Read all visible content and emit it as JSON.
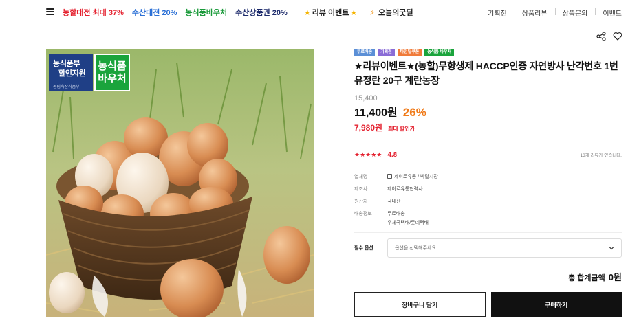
{
  "topnav": {
    "promos": [
      {
        "label": "농할대전 최대 37%",
        "color": "#e4202e"
      },
      {
        "label": "수산대전 20%",
        "color": "#2a6fd6"
      },
      {
        "label": "농식품바우처",
        "color": "#1a9a3a"
      },
      {
        "label": "수산상품권 20%",
        "color": "#1c2a6b"
      }
    ],
    "review_event": "리뷰 이벤트",
    "today_deal": "오늘의굿딜",
    "right_links": [
      "기획전",
      "상품리뷰",
      "상품문의",
      "이벤트"
    ]
  },
  "image": {
    "badge_line1": "농식품부",
    "badge_line2": "할인지원",
    "badge_line3": "농림축산식품부",
    "voucher_line1": "농식품",
    "voucher_line2": "바우처"
  },
  "product": {
    "tags": [
      "무료배송",
      "기획전",
      "타임딜쿠폰",
      "농식품 바우처"
    ],
    "title": "★리뷰이벤트★(농할)무항생제 HACCP인증 자연방사 난각번호 1번 유정란 20구 계란농장",
    "original_price": "15,400",
    "price": "11,400원",
    "discount": "26%",
    "max_discount_price": "7,980원",
    "max_discount_label": "최대 할인가",
    "rating": "4.8",
    "review_count": "13개 리뷰가 있습니다.",
    "meta": {
      "seller_label": "업체명",
      "seller_value": "제이로유통 / 박달시장",
      "maker_label": "제조사",
      "maker_value": "제이로유통협력사",
      "origin_label": "원산지",
      "origin_value": "국내산",
      "shipping_label": "배송정보",
      "shipping_value1": "무료배송",
      "shipping_value2": "우체국택배/롯데택배"
    },
    "option_label": "필수 옵션",
    "option_placeholder": "옵션을 선택해주세요.",
    "total_label": "총 합계금액",
    "total_value": "0원",
    "cart_button": "장바구니 담기",
    "buy_button": "구매하기"
  },
  "colors": {
    "accent_red": "#e4202e",
    "discount_orange": "#f07b1a",
    "button_dark": "#111111"
  }
}
